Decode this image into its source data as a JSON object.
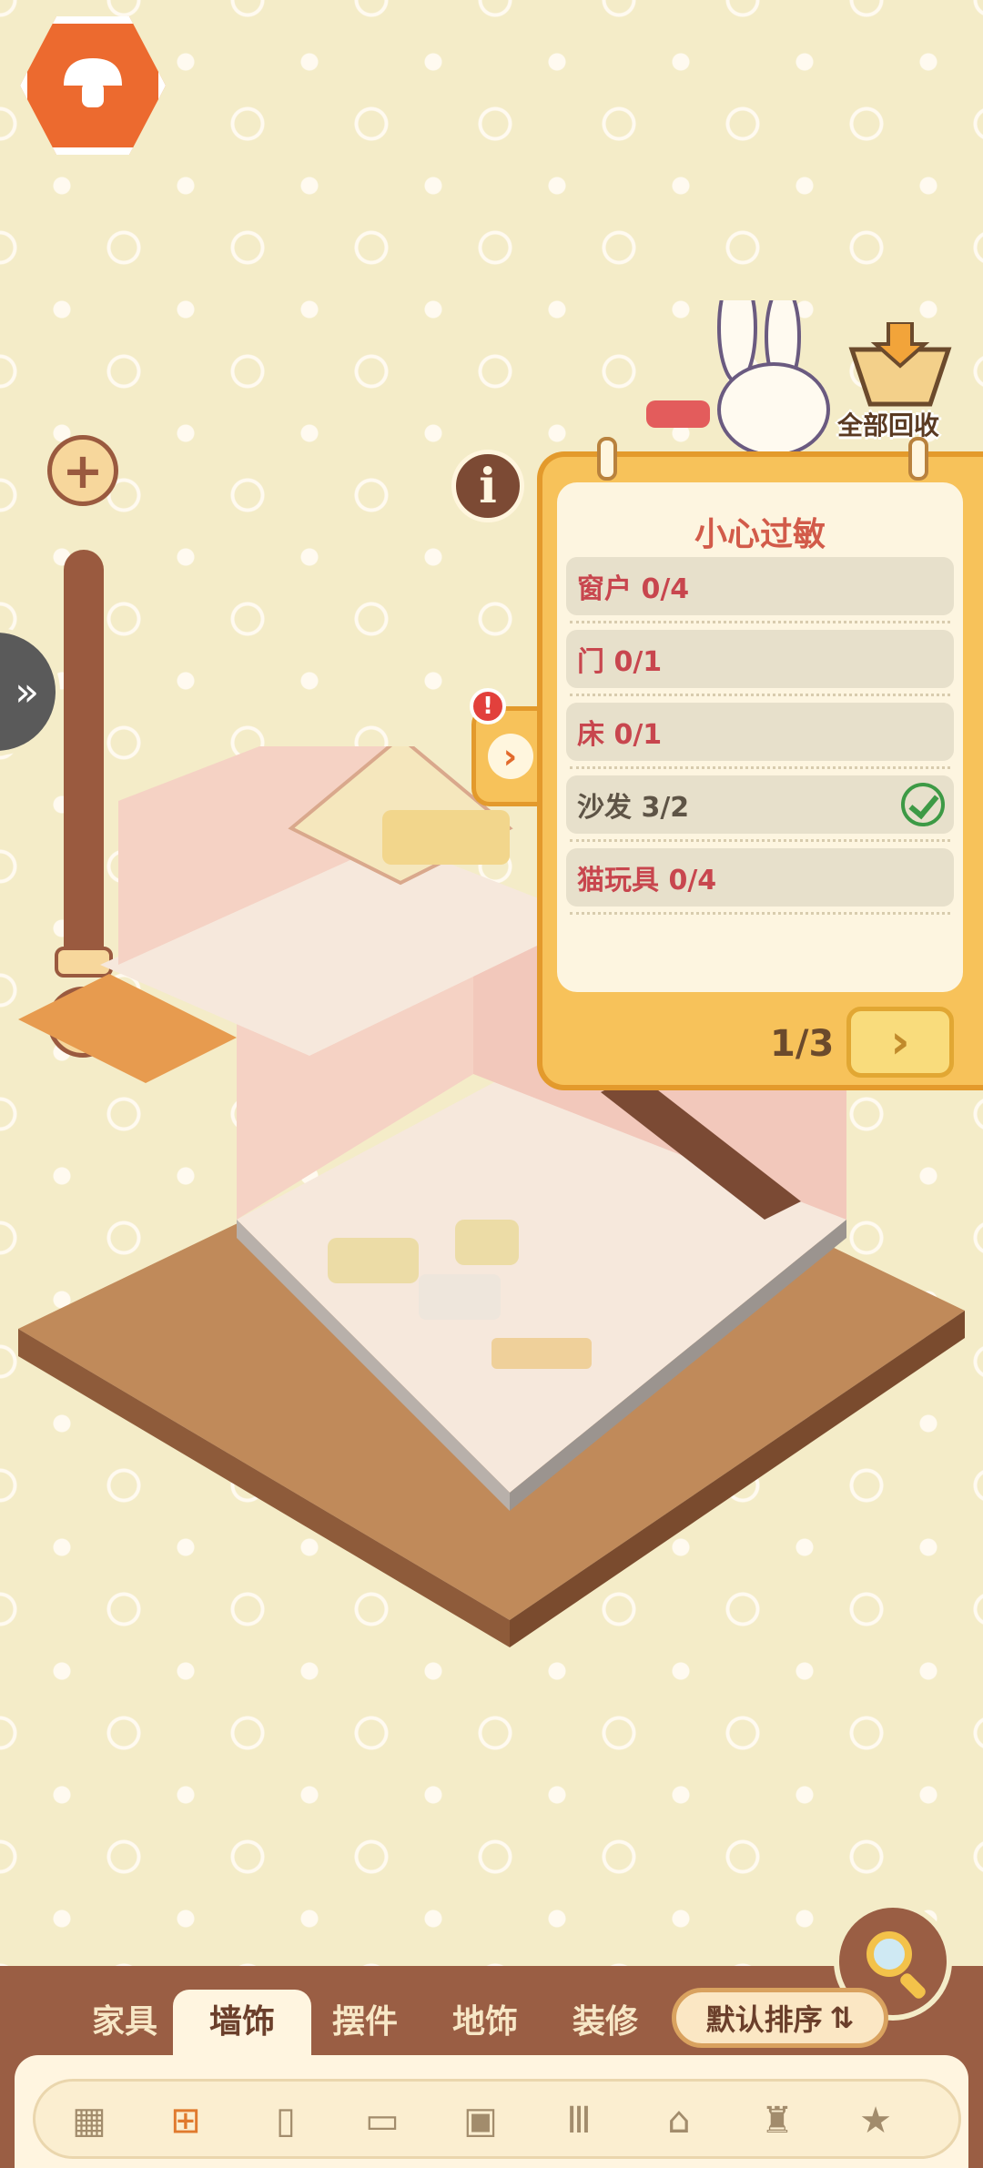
{
  "quest_panel": {
    "title": "小心过敏",
    "items": [
      {
        "label": "窗户 0/4",
        "completed": false
      },
      {
        "label": "门 0/1",
        "completed": false
      },
      {
        "label": "床 0/1",
        "completed": false
      },
      {
        "label": "沙发 3/2",
        "completed": true
      },
      {
        "label": "猫玩具 0/4",
        "completed": false
      }
    ],
    "page": "1/3"
  },
  "toolbar": {
    "recycle_all_label": "全部回收",
    "info_label": "i",
    "zoom_in_label": "+",
    "zoom_out_label": "−"
  },
  "bottom_tabs": {
    "tabs": [
      "家具",
      "墙饰",
      "摆件",
      "地饰",
      "装修"
    ],
    "active_index": 1,
    "sort_label": "默认排序"
  },
  "category_icons": [
    "grid-icon",
    "window-icon",
    "door-icon",
    "bed-icon",
    "picture-frame-icon",
    "wall-shelf-icon",
    "shower-icon",
    "wall-lamp-icon",
    "star-decor-icon"
  ],
  "colors": {
    "background": "#f4ecc8",
    "panel": "#f7c25a",
    "accent_red": "#c8464e",
    "wood_brown": "#9a5e44",
    "home_badge": "#ec6a2f"
  }
}
